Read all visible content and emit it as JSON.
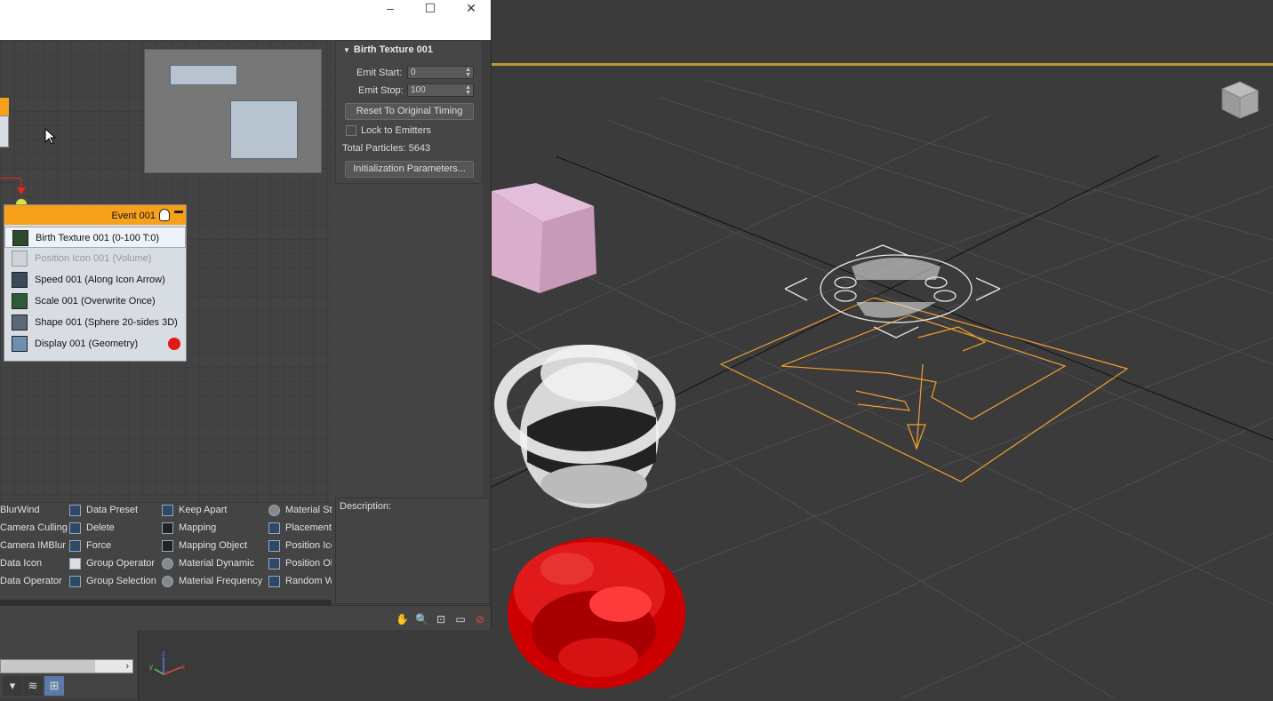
{
  "window": {
    "minimize_glyph": "–",
    "maximize_glyph": "☐",
    "close_glyph": "✕"
  },
  "event": {
    "title": "Event 001",
    "operators": [
      {
        "label": "Birth Texture 001 (0-100 T:0)",
        "state": "selected"
      },
      {
        "label": "Position Icon 001 (Volume)",
        "state": "disabled"
      },
      {
        "label": "Speed 001 (Along Icon Arrow)",
        "state": "normal"
      },
      {
        "label": "Scale 001 (Overwrite Once)",
        "state": "normal"
      },
      {
        "label": "Shape 001 (Sphere 20-sides 3D)",
        "state": "normal"
      },
      {
        "label": "Display 001 (Geometry)",
        "state": "normal"
      }
    ]
  },
  "depot": {
    "col1": [
      "BlurWind",
      "Camera Culling",
      "Camera IMBlur",
      "Data Icon",
      "Data Operator"
    ],
    "col2": [
      "Data Preset",
      "Delete",
      "Force",
      "Group Operator",
      "Group Selection"
    ],
    "col3": [
      "Keep Apart",
      "Mapping",
      "Mapping Object",
      "Material Dynamic",
      "Material Frequency"
    ],
    "col4": [
      "Material St",
      "Placement",
      "Position Ico",
      "Position Ob",
      "Random W"
    ]
  },
  "rollout": {
    "title": "Birth Texture 001",
    "emit_start_label": "Emit Start:",
    "emit_start_value": "0",
    "emit_stop_label": "Emit Stop:",
    "emit_stop_value": "100",
    "reset_button": "Reset To Original Timing",
    "lock_label": "Lock to Emitters",
    "total_particles": "Total Particles: 5643",
    "init_button": "Initialization Parameters..."
  },
  "description": {
    "label": "Description:"
  },
  "viewport": {
    "accent_color": "#f0a030",
    "border_color": "#b99b3a"
  }
}
